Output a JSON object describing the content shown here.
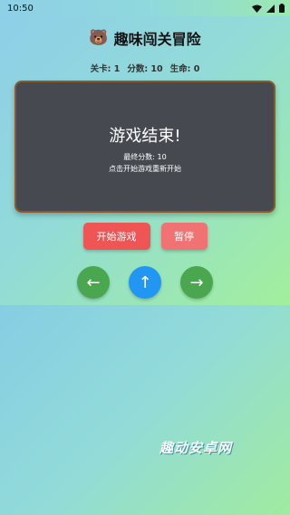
{
  "status_bar": {
    "time": "10:50"
  },
  "app": {
    "title": "趣味闯关冒险",
    "title_icon": "🐻",
    "stats": {
      "level": "关卡: 1",
      "score": "分数: 10",
      "lives": "生命: 0"
    },
    "game_over": {
      "title": "游戏结束!",
      "final_score": "最终分数: 10",
      "hint": "点击开始游戏重新开始"
    },
    "buttons": {
      "start": "开始游戏",
      "pause": "暂停"
    },
    "controls": {
      "left": "←",
      "up": "↑",
      "right": "→"
    }
  },
  "watermark": "趣动安卓网",
  "colors": {
    "start_button": "#f05555",
    "pause_button": "#f07272",
    "control_green": "#4aa64f",
    "control_blue": "#2196f3",
    "panel_bg": "#464a50",
    "panel_border": "#8a5a2b"
  }
}
